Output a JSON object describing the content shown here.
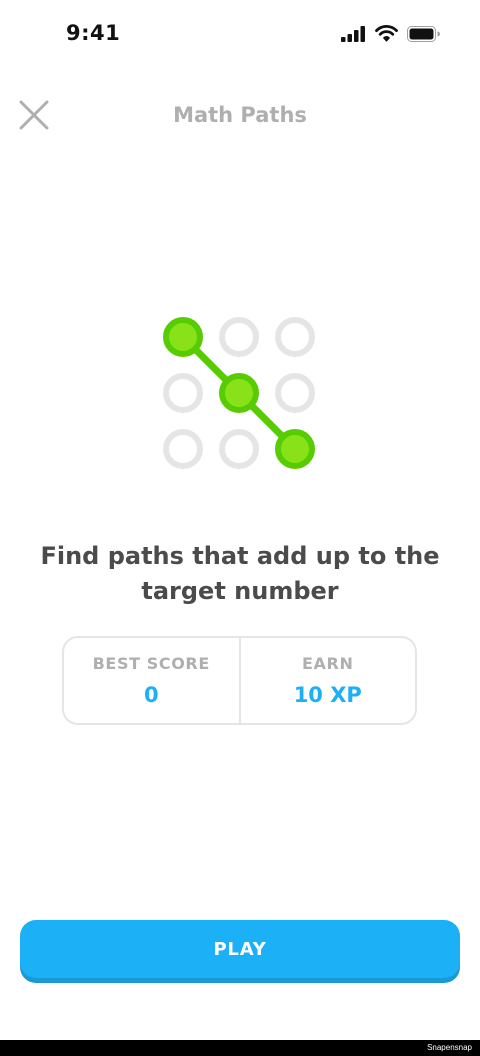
{
  "status_bar": {
    "time": "9:41",
    "icons": [
      "signal-icon",
      "wifi-icon",
      "battery-icon"
    ]
  },
  "header": {
    "title": "Math Paths",
    "close_icon": "close-icon"
  },
  "illustration": {
    "icon": "math-path-grid-icon",
    "grid": "3x3",
    "highlighted_path": [
      "top-left",
      "center",
      "bottom-right"
    ],
    "colors": {
      "active": "#58cc02",
      "active_fill": "#89e219",
      "inactive": "#e5e5e5"
    }
  },
  "description": "Find paths that add up to the target number",
  "stats": {
    "best_score": {
      "label": "BEST SCORE",
      "value": "0"
    },
    "earn": {
      "label": "EARN",
      "value": "10 XP"
    }
  },
  "play_button": {
    "label": "PLAY"
  },
  "colors": {
    "accent": "#1cb0f6",
    "title_gray": "#afafaf",
    "text_dark": "#4b4b4b"
  },
  "watermark": "Snapensnap"
}
